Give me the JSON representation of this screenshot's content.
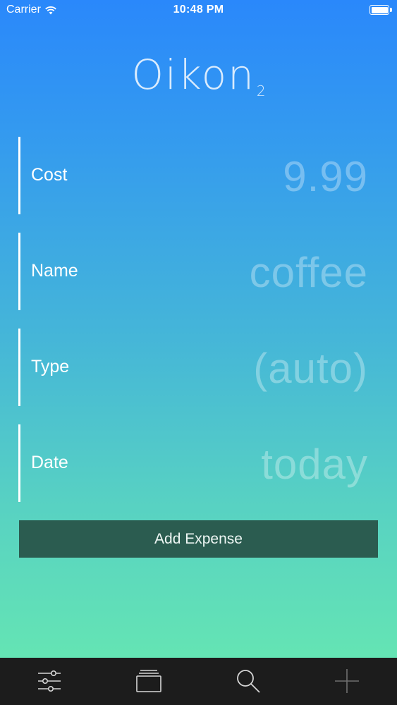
{
  "status_bar": {
    "carrier": "Carrier",
    "time": "10:48 PM"
  },
  "logo": {
    "main": "Oikon",
    "subscript": "2"
  },
  "form": {
    "cost": {
      "label": "Cost",
      "value": "9.99"
    },
    "name": {
      "label": "Name",
      "value": "coffee"
    },
    "type": {
      "label": "Type",
      "value": "(auto)"
    },
    "date": {
      "label": "Date",
      "value": "today"
    }
  },
  "add_button_label": "Add Expense",
  "tab_bar": {
    "tabs": [
      {
        "icon": "sliders-icon"
      },
      {
        "icon": "stack-icon"
      },
      {
        "icon": "search-icon"
      },
      {
        "icon": "plus-icon"
      }
    ]
  },
  "colors": {
    "gradient_top": "#2a88fb",
    "gradient_bottom": "#68eaaf",
    "button_bg": "#2b5c50",
    "tab_bar_bg": "#1c1c1c"
  }
}
